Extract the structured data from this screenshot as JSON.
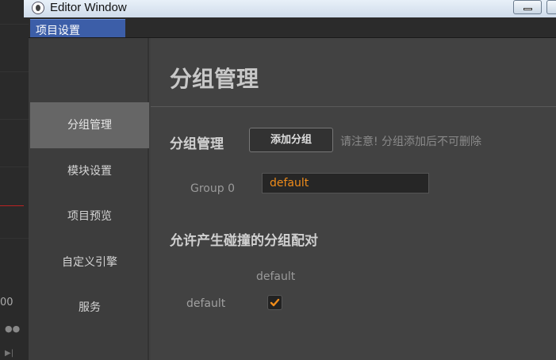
{
  "window": {
    "title": "Editor Window"
  },
  "tabs": [
    {
      "label": "项目设置"
    }
  ],
  "background": {
    "axis_value": "00"
  },
  "sidebar": {
    "items": [
      {
        "label": "分组管理",
        "active": true
      },
      {
        "label": "模块设置",
        "active": false
      },
      {
        "label": "项目预览",
        "active": false
      },
      {
        "label": "自定义引擎",
        "active": false
      },
      {
        "label": "服务",
        "active": false
      }
    ]
  },
  "main": {
    "page_title": "分组管理",
    "group_section": {
      "title": "分组管理",
      "add_button": "添加分组",
      "hint": "请注意! 分组添加后不可删除",
      "groups": [
        {
          "label": "Group 0",
          "value": "default"
        }
      ]
    },
    "collision_section": {
      "title": "允许产生碰撞的分组配对",
      "column_headers": [
        "default"
      ],
      "row_headers": [
        "default"
      ],
      "matrix": [
        [
          true
        ]
      ]
    }
  },
  "colors": {
    "accent_orange": "#f08c1a",
    "tab_blue": "#3c5ea8"
  }
}
